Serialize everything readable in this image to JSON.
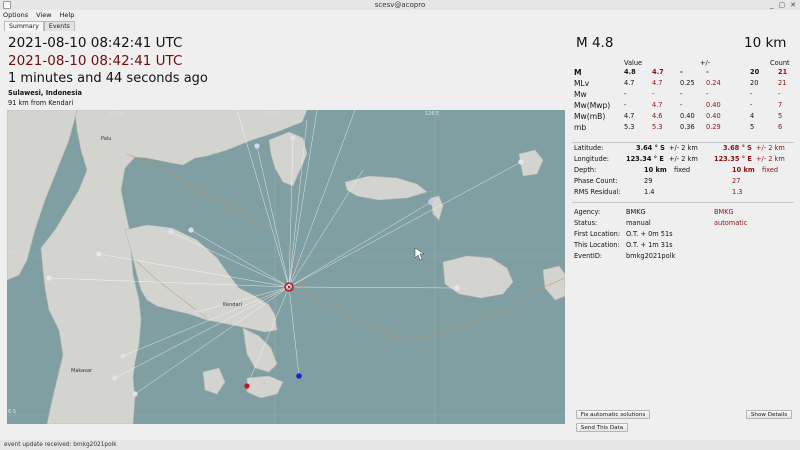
{
  "window": {
    "title": "scesv@acopro",
    "controls": [
      "_",
      "▢",
      "✕"
    ]
  },
  "menu": [
    "Options",
    "View",
    "Help"
  ],
  "tabs": [
    "Summary",
    "Events"
  ],
  "header": {
    "origin_time_utc": "2021-08-10 08:42:41 UTC",
    "origin_time_utc_automatic": "2021-08-10 08:42:41 UTC",
    "elapsed": "1 minutes and 44 seconds ago",
    "region": "Sulawesi, Indonesia",
    "nearest_city": "91 km from Kendari",
    "magnitude": "M 4.8",
    "depth": "10 km"
  },
  "magnitudes": {
    "headers": {
      "value": "Value",
      "pm": "+/-",
      "count": "Count"
    },
    "rows": [
      {
        "type": "M",
        "val": "4.8",
        "val_auto": "4.7",
        "err": "-",
        "err_auto": "-",
        "cnt": "20",
        "cnt_auto": "21",
        "bold": true
      },
      {
        "type": "MLv",
        "val": "4.7",
        "val_auto": "4.7",
        "err": "0.25",
        "err_auto": "0.24",
        "cnt": "20",
        "cnt_auto": "21",
        "bold": false
      },
      {
        "type": "Mw",
        "val": "-",
        "val_auto": "-",
        "err": "-",
        "err_auto": "-",
        "cnt": "-",
        "cnt_auto": "-",
        "bold": false
      },
      {
        "type": "Mw(Mwp)",
        "val": "-",
        "val_auto": "4.7",
        "err": "-",
        "err_auto": "0.40",
        "cnt": "-",
        "cnt_auto": "7",
        "bold": false
      },
      {
        "type": "Mw(mB)",
        "val": "4.7",
        "val_auto": "4.6",
        "err": "0.40",
        "err_auto": "0.40",
        "cnt": "4",
        "cnt_auto": "5",
        "bold": false
      },
      {
        "type": "mb",
        "val": "5.3",
        "val_auto": "5.3",
        "err": "0.36",
        "err_auto": "0.29",
        "cnt": "5",
        "cnt_auto": "6",
        "bold": false
      }
    ]
  },
  "location": {
    "latitude_label": "Latitude:",
    "latitude": "3.64 ° S",
    "latitude_err": "+/-  2 km",
    "latitude_auto": "3.68 ° S",
    "latitude_auto_err": "+/-  2 km",
    "longitude_label": "Longitude:",
    "longitude": "123.34 ° E",
    "longitude_err": "+/-  2 km",
    "longitude_auto": "123.35 ° E",
    "longitude_auto_err": "+/-  2 km",
    "depth_label": "Depth:",
    "depth": "10 km",
    "depth_status": "fixed",
    "depth_auto": "10 km",
    "depth_auto_status": "fixed",
    "phase_label": "Phase Count:",
    "phase": "29",
    "phase_auto": "27",
    "rms_label": "RMS Residual:",
    "rms": "1.4",
    "rms_auto": "1.3"
  },
  "info": {
    "agency_label": "Agency:",
    "agency": "BMKG",
    "agency_auto": "BMKG",
    "status_label": "Status:",
    "status": "manual",
    "status_auto": "automatic",
    "first_label": "First Location:",
    "first": "O.T. + 0m 51s",
    "this_label": "This Location:",
    "this": "O.T. + 1m 31s",
    "eventid_label": "EventID:",
    "eventid": "bmkg2021polk"
  },
  "buttons": {
    "fix": "Fix automatic solutions",
    "show": "Show Details",
    "send": "Send This Data"
  },
  "map": {
    "lon_labels": [
      "120 E",
      "123 E",
      "126 E"
    ],
    "lat_labels": [
      "3 S",
      "6 S"
    ],
    "places": [
      "Palu",
      "Kendari",
      "Makasar"
    ],
    "colors": {
      "sea": "#809fa3",
      "land": "#d3d3cf",
      "epicenter": "#c8141e",
      "rays": "#ffffff"
    }
  },
  "statusbar": "event update received: bmkg2021polk"
}
